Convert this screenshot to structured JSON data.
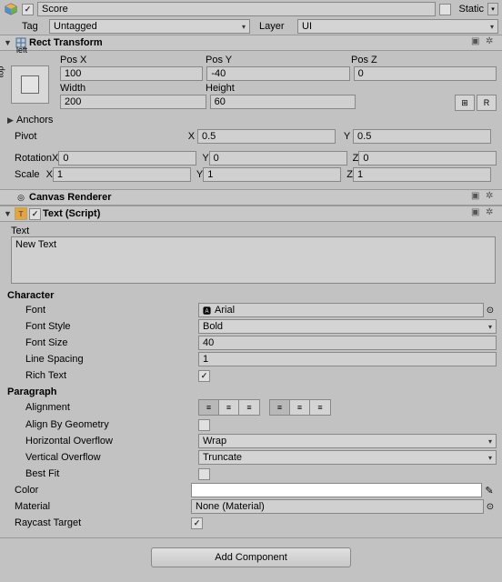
{
  "header": {
    "name": "Score",
    "static_label": "Static",
    "static_checked": false,
    "active_checked": true
  },
  "tag_layer": {
    "tag_label": "Tag",
    "tag_value": "Untagged",
    "layer_label": "Layer",
    "layer_value": "UI"
  },
  "rect_transform": {
    "title": "Rect Transform",
    "anchor_left": "left",
    "anchor_top": "top",
    "posx_label": "Pos X",
    "posy_label": "Pos Y",
    "posz_label": "Pos Z",
    "posx": "100",
    "posy": "-40",
    "posz": "0",
    "width_label": "Width",
    "height_label": "Height",
    "width": "200",
    "height": "60",
    "btn_blueprint": "⊞",
    "btn_raw": "R",
    "anchors_label": "Anchors",
    "pivot_label": "Pivot",
    "pivot_x": "0.5",
    "pivot_y": "0.5",
    "rotation_label": "Rotation",
    "rot_x": "0",
    "rot_y": "0",
    "rot_z": "0",
    "scale_label": "Scale",
    "scl_x": "1",
    "scl_y": "1",
    "scl_z": "1"
  },
  "canvas_renderer": {
    "title": "Canvas Renderer"
  },
  "text_comp": {
    "title": "Text (Script)",
    "enabled": true,
    "text_label": "Text",
    "text_value": "New Text",
    "character_label": "Character",
    "font_label": "Font",
    "font_value": "Arial",
    "font_style_label": "Font Style",
    "font_style_value": "Bold",
    "font_size_label": "Font Size",
    "font_size_value": "40",
    "line_spacing_label": "Line Spacing",
    "line_spacing_value": "1",
    "rich_text_label": "Rich Text",
    "rich_text_checked": true,
    "paragraph_label": "Paragraph",
    "alignment_label": "Alignment",
    "align_by_geo_label": "Align By Geometry",
    "align_by_geo_checked": false,
    "h_overflow_label": "Horizontal Overflow",
    "h_overflow_value": "Wrap",
    "v_overflow_label": "Vertical Overflow",
    "v_overflow_value": "Truncate",
    "best_fit_label": "Best Fit",
    "best_fit_checked": false,
    "color_label": "Color",
    "color_value": "#ffffff",
    "material_label": "Material",
    "material_value": "None (Material)",
    "raycast_label": "Raycast Target",
    "raycast_checked": true
  },
  "add_component": "Add Component",
  "labels": {
    "x": "X",
    "y": "Y",
    "z": "Z"
  }
}
